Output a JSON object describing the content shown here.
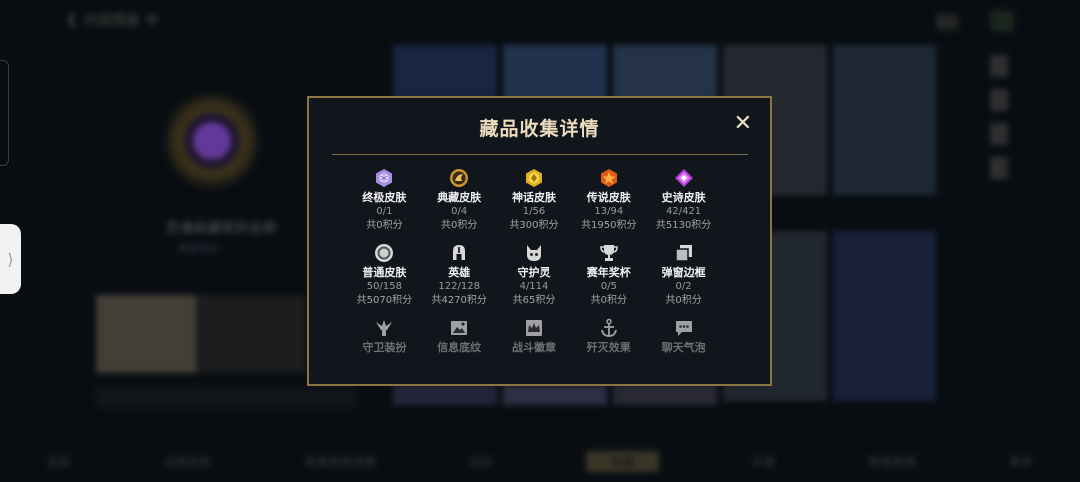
{
  "background": {
    "back_label": "内容图鉴",
    "player_name": "灵魂收藏家的名称",
    "player_sub": "图鉴等级",
    "bottom_tabs": [
      "全部",
      "全部皮肤",
      "英雄皮肤收集",
      "炫彩",
      "收藏",
      "头像",
      "图鉴数据",
      "更多"
    ]
  },
  "modal": {
    "title": "藏品收集详情",
    "close_label": "✕",
    "items": [
      {
        "icon": "ultimate-skin-icon",
        "name": "终极皮肤",
        "count": "0/1",
        "points": "共0积分"
      },
      {
        "icon": "legacy-skin-icon",
        "name": "典藏皮肤",
        "count": "0/4",
        "points": "共0积分"
      },
      {
        "icon": "mythic-skin-icon",
        "name": "神话皮肤",
        "count": "1/56",
        "points": "共300积分"
      },
      {
        "icon": "legendary-skin-icon",
        "name": "传说皮肤",
        "count": "13/94",
        "points": "共1950积分"
      },
      {
        "icon": "epic-skin-icon",
        "name": "史诗皮肤",
        "count": "42/421",
        "points": "共5130积分"
      },
      {
        "icon": "standard-skin-icon",
        "name": "普通皮肤",
        "count": "50/158",
        "points": "共5070积分"
      },
      {
        "icon": "champion-icon",
        "name": "英雄",
        "count": "122/128",
        "points": "共4270积分"
      },
      {
        "icon": "ward-icon",
        "name": "守护灵",
        "count": "4/114",
        "points": "共65积分"
      },
      {
        "icon": "trophy-icon",
        "name": "赛年奖杯",
        "count": "0/5",
        "points": "共0积分"
      },
      {
        "icon": "frame-icon",
        "name": "弹窗边框",
        "count": "0/2",
        "points": "共0积分"
      },
      {
        "icon": "guardian-icon",
        "name": "守卫装扮",
        "count": "",
        "points": ""
      },
      {
        "icon": "banner-icon",
        "name": "信息底纹",
        "count": "",
        "points": ""
      },
      {
        "icon": "crown-icon",
        "name": "战斗徽章",
        "count": "",
        "points": ""
      },
      {
        "icon": "anchor-icon",
        "name": "歼灭效果",
        "count": "",
        "points": ""
      },
      {
        "icon": "chat-icon",
        "name": "聊天气泡",
        "count": "",
        "points": ""
      }
    ]
  },
  "side_tab": {
    "label": "⟩"
  }
}
